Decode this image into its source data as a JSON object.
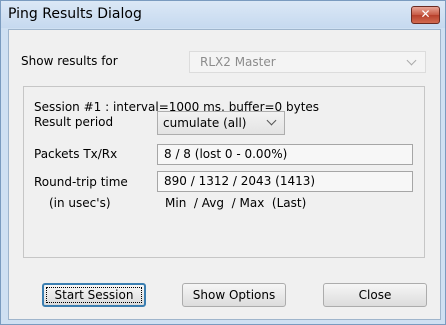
{
  "window": {
    "title": "Ping Results Dialog",
    "close_glyph": "✕"
  },
  "show_results": {
    "label": "Show results for",
    "selected": "RLX2 Master"
  },
  "session": {
    "info": "Session #1 : interval=1000 ms, buffer=0 bytes",
    "result_period": {
      "label": "Result period",
      "selected": "cumulate (all)"
    },
    "packets": {
      "label": "Packets Tx/Rx",
      "value": "8 / 8  (lost 0 - 0.00%)"
    },
    "round_trip": {
      "label": "Round-trip time",
      "sublabel": "(in usec's)",
      "value": "890 / 1312 / 2043 (1413)",
      "legend": "Min  / Avg  / Max  (Last)"
    }
  },
  "buttons": {
    "start": "Start Session",
    "options": "Show Options",
    "close": "Close"
  }
}
